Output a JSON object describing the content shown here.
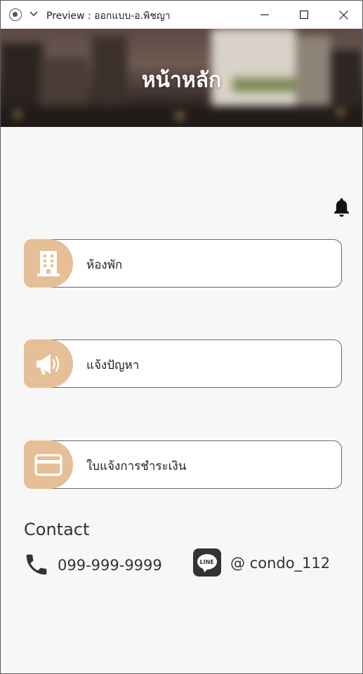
{
  "window": {
    "title": "Preview : ออกแบบ-อ.พิชญา"
  },
  "header": {
    "title": "หน้าหลัก"
  },
  "menu": [
    {
      "label": "ห้องพัก",
      "icon": "building-icon"
    },
    {
      "label": "แจ้งปัญหา",
      "icon": "megaphone-icon"
    },
    {
      "label": "ใบแจ้งการชำระเงิน",
      "icon": "credit-card-icon"
    }
  ],
  "contact": {
    "title": "Contact",
    "phone": "099-999-9999",
    "line": "@ condo_112"
  },
  "colors": {
    "accent": "#e5bf95",
    "background": "#f7f7f7"
  }
}
